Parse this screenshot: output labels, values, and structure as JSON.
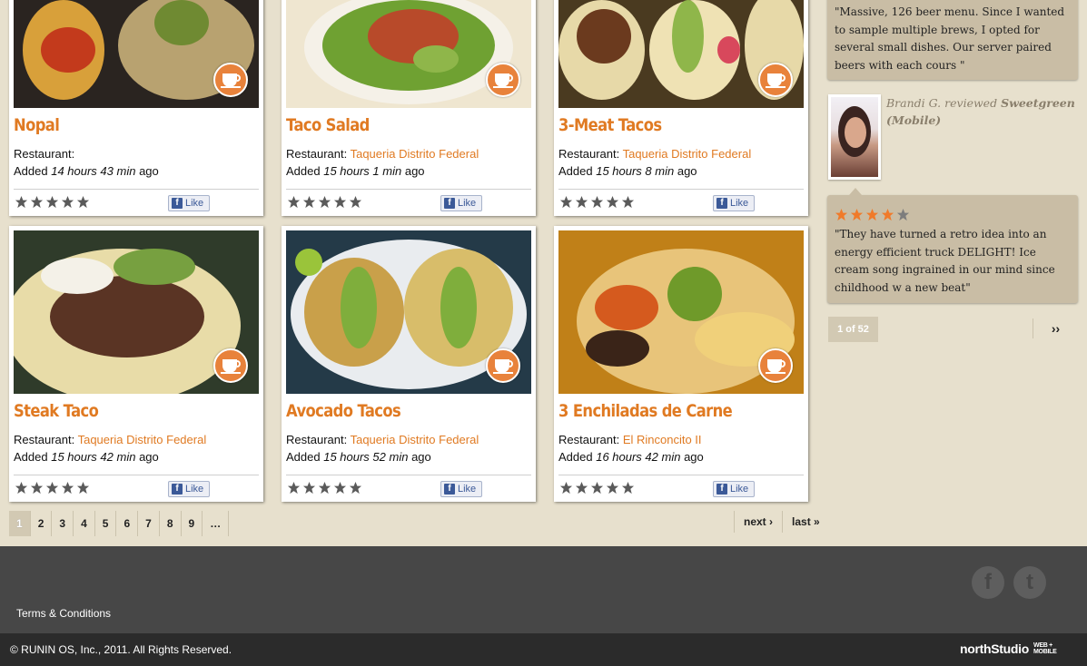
{
  "cards": [
    {
      "title": "Nopal",
      "restaurant_label": "Restaurant:",
      "restaurant": "",
      "added_prefix": "Added",
      "time": "14 hours 43 min",
      "ago": "ago",
      "like": "Like"
    },
    {
      "title": "Taco Salad",
      "restaurant_label": "Restaurant:",
      "restaurant": "Taqueria Distrito Federal",
      "added_prefix": "Added",
      "time": "15 hours 1 min",
      "ago": "ago",
      "like": "Like"
    },
    {
      "title": "3-Meat Tacos",
      "restaurant_label": "Restaurant:",
      "restaurant": "Taqueria Distrito Federal",
      "added_prefix": "Added",
      "time": "15 hours 8 min",
      "ago": "ago",
      "like": "Like"
    },
    {
      "title": "Steak Taco",
      "restaurant_label": "Restaurant:",
      "restaurant": "Taqueria Distrito Federal",
      "added_prefix": "Added",
      "time": "15 hours 42 min",
      "ago": "ago",
      "like": "Like"
    },
    {
      "title": "Avocado Tacos",
      "restaurant_label": "Restaurant:",
      "restaurant": "Taqueria Distrito Federal",
      "added_prefix": "Added",
      "time": "15 hours 52 min",
      "ago": "ago",
      "like": "Like"
    },
    {
      "title": "3 Enchiladas de Carne",
      "restaurant_label": "Restaurant:",
      "restaurant": "El Rinconcito II",
      "added_prefix": "Added",
      "time": "16 hours 42 min",
      "ago": "ago",
      "like": "Like"
    }
  ],
  "pager": {
    "pages": [
      "1",
      "2",
      "3",
      "4",
      "5",
      "6",
      "7",
      "8",
      "9",
      "…"
    ],
    "active": "1",
    "next": "next ›",
    "last": "last »"
  },
  "sidebar": {
    "quote1": "\"Massive, 126 beer menu. Since I wanted to sample multiple brews, I opted for several small dishes. Our server paired beers with each cours \"",
    "reviewer": "Brandi G.",
    "reviewed": "reviewed",
    "place": "Sweetgreen (Mobile)",
    "rating": 4,
    "rating_max": 5,
    "quote2": "\"They have turned a retro idea into an energy efficient truck DELIGHT! Ice cream song ingrained in our mind since childhood w a new beat\"",
    "count": "1 of 52",
    "next": "››"
  },
  "footer": {
    "terms": "Terms & Conditions",
    "copyright": "© RUNIN OS, Inc., 2011. All Rights Reserved.",
    "brand": "northStudio",
    "brand_tag_1": "WEB +",
    "brand_tag_2": "MOBILE",
    "social": [
      {
        "icon": "facebook-icon",
        "glyph": "f"
      },
      {
        "icon": "twitter-icon",
        "glyph": "t"
      }
    ]
  },
  "colors": {
    "accent": "#e07a22",
    "background": "#e7e0cd",
    "footer": "#474747",
    "footer_bottom": "#2b2b2b",
    "bubble": "#c9bda5",
    "star_on": "#f07a2a"
  }
}
